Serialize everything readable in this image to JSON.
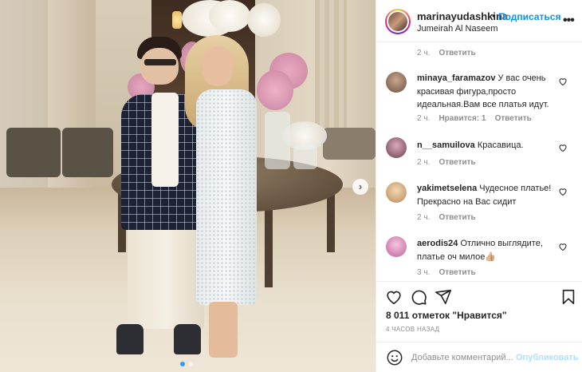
{
  "header": {
    "username": "marinayudashkina",
    "separator": "•",
    "follow_label": "Подписаться",
    "location": "Jumeirah Al Naseem",
    "more_label": "•••"
  },
  "photo": {
    "next_label": "›",
    "slides_total": 2,
    "slide_active": 1
  },
  "comments": {
    "first_meta": {
      "time": "2 ч.",
      "reply": "Ответить"
    },
    "items": [
      {
        "username": "minaya_faramazov",
        "text": "У вас очень красивая фигура,просто идеальная.Вам все платья идут.",
        "time": "2 ч.",
        "likes": "Нравится: 1",
        "reply": "Ответить",
        "avatar_color": "#8a7060"
      },
      {
        "username": "n__samuilova",
        "text": "Красавица.",
        "time": "2 ч.",
        "reply": "Ответить",
        "avatar_color": "#9a6a7a"
      },
      {
        "username": "yakimetselena",
        "text": "Чудесное платье! Прекрасно на Вас сидит",
        "time": "2 ч.",
        "reply": "Ответить",
        "avatar_color": "#d9b488"
      },
      {
        "username": "aerodis24",
        "text": "Отлично выглядите, платье оч милое👍🏼",
        "time": "3 ч.",
        "reply": "Ответить",
        "avatar_color": "#d07ab0"
      }
    ]
  },
  "actions": {
    "icons": [
      "heart-icon",
      "comment-icon",
      "share-icon",
      "bookmark-icon"
    ],
    "likes_text": "8 011 отметок \"Нравится\"",
    "time_ago": "4 ЧАСОВ НАЗАД"
  },
  "add_comment": {
    "placeholder": "Добавьте комментарий...",
    "post_label": "Опубликовать"
  },
  "colors": {
    "link_blue": "#0095f6",
    "post_disabled": "#b2dffc",
    "muted": "#8e8e8e",
    "text": "#262626"
  }
}
